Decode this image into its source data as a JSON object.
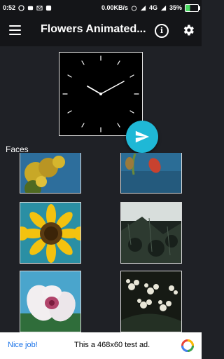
{
  "status_bar": {
    "time": "0:52",
    "network_speed": "0.00KB/s",
    "network_type": "4G",
    "battery": "35%"
  },
  "app_bar": {
    "title": "Flowers Animated...",
    "menu_icon": "hamburger-menu-icon",
    "info_icon": "info-icon",
    "info_glyph": "i",
    "settings_icon": "gear-icon"
  },
  "preview": {
    "type": "analog-clock",
    "fab_icon": "send-icon"
  },
  "faces_section": {
    "label": "Faces",
    "items": [
      {
        "name": "yellow-flowers-blue-sky"
      },
      {
        "name": "red-bud-blue-background"
      },
      {
        "name": "sunflowers"
      },
      {
        "name": "dark-foliage"
      },
      {
        "name": "white-pink-lily"
      },
      {
        "name": "white-jasmine"
      }
    ]
  },
  "ad": {
    "left_text": "Nice job!",
    "center_text": "This a 468x60 test ad.",
    "logo_icon": "ad-logo-icon"
  },
  "colors": {
    "background": "#1f2126",
    "bar": "#141518",
    "accent": "#1fb8d6"
  }
}
